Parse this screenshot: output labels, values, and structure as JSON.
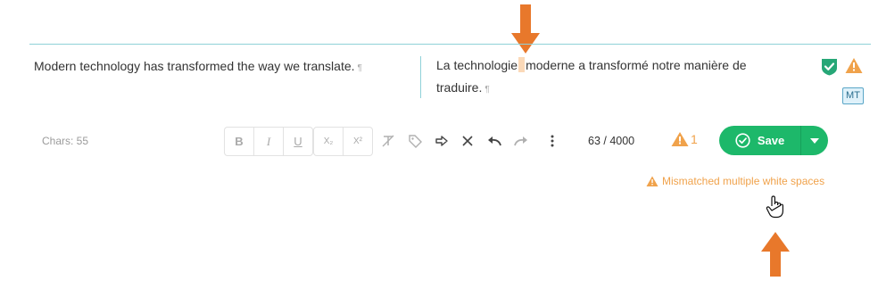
{
  "segment": {
    "source_text": "Modern technology has transformed the way we translate.",
    "target_text_before": "La technologie",
    "target_text_after": "moderne a transformé notre manière de traduire.",
    "pilcrow": "¶",
    "mt_badge": "MT"
  },
  "toolbar": {
    "chars_label": "Chars: 55",
    "format_buttons": [
      "B",
      "I",
      "U",
      "X₂",
      "X²"
    ],
    "counter": "63 / 4000",
    "qa_count": "1",
    "save_label": "Save"
  },
  "qa": {
    "message": "Mismatched multiple white spaces"
  },
  "icons": {
    "status_confirmed": "shield-check-icon",
    "status_warning": "warning-icon",
    "clear_format": "clear-format-icon",
    "tag": "tag-icon",
    "copy_source": "arrow-right-icon",
    "clear_target": "close-icon",
    "undo": "undo-icon",
    "redo": "redo-icon",
    "more": "more-vertical-icon"
  },
  "colors": {
    "accent_teal": "#8fd1d8",
    "save_green": "#1db86a",
    "warning_orange": "#f0a24b",
    "annotation_arrow": "#e8782b"
  }
}
